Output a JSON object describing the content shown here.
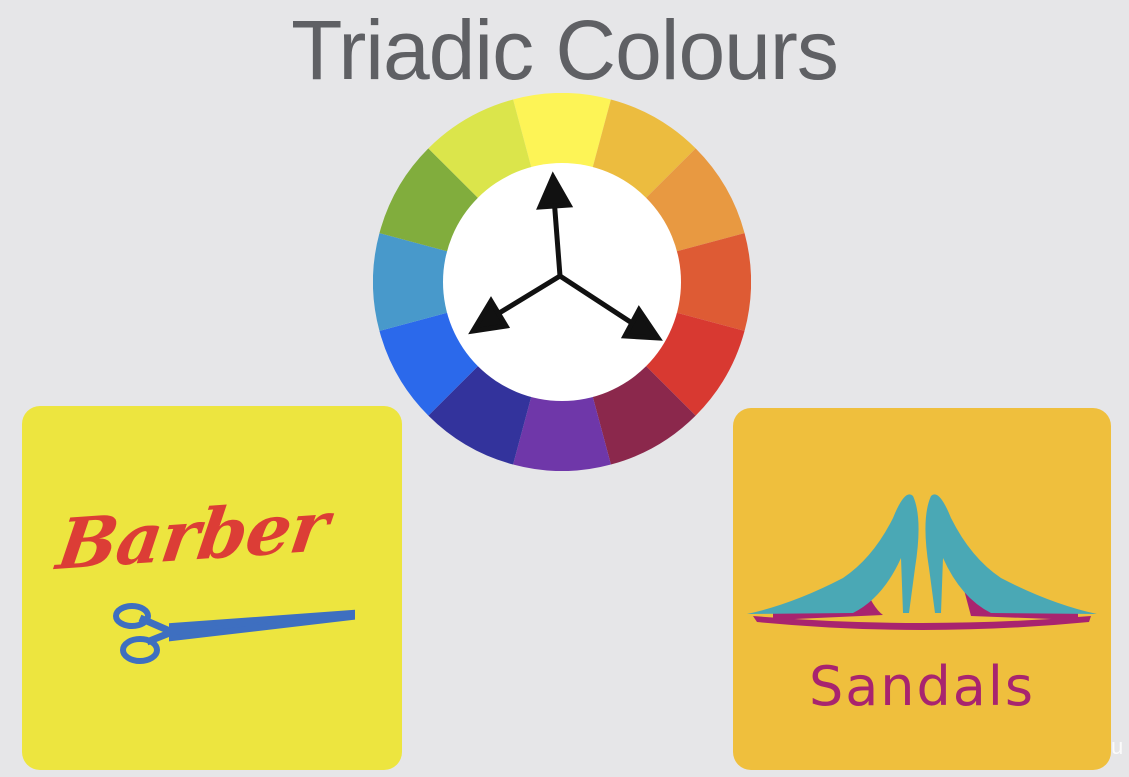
{
  "slide": {
    "title": "Triadic Colours"
  },
  "color_wheel": {
    "segments": [
      "#fdf456",
      "#ecbc3f",
      "#e89941",
      "#de5b34",
      "#d83931",
      "#8b284c",
      "#6f37a9",
      "#33339c",
      "#2b69eb",
      "#4899cb",
      "#81ad3d",
      "#dbe54b"
    ],
    "center": "#ffffff",
    "arrow_icon": "triadic-arrows-icon"
  },
  "barber_logo": {
    "background": "#ede53f",
    "text": "Barber",
    "text_color": "#dc3d36",
    "scissors_color": "#3e6fc0",
    "icon": "scissors-icon"
  },
  "sandals_logo": {
    "background": "#efbf3d",
    "text": "Sandals",
    "text_color": "#a8246f",
    "shoe_color": "#4aa8b5",
    "sole_color": "#a8246f",
    "icon": "high-heel-shoes-icon"
  },
  "watermark": {
    "text": "u"
  }
}
